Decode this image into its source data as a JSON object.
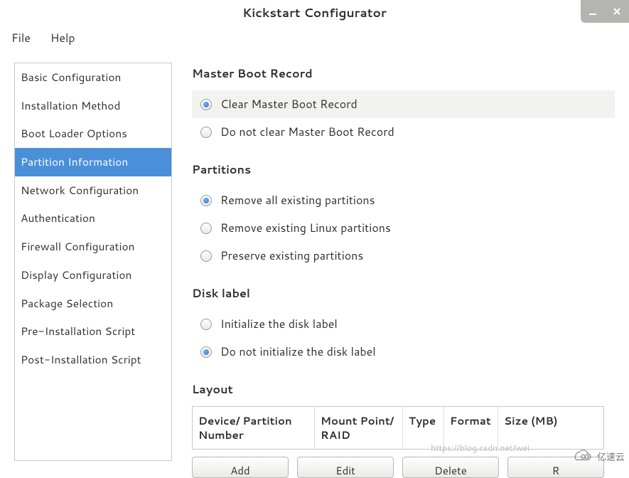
{
  "window": {
    "title": "Kickstart Configurator"
  },
  "menubar": {
    "file": "File",
    "help": "Help"
  },
  "sidebar": {
    "items": [
      "Basic Configuration",
      "Installation Method",
      "Boot Loader Options",
      "Partition Information",
      "Network Configuration",
      "Authentication",
      "Firewall Configuration",
      "Display Configuration",
      "Package Selection",
      "Pre-Installation Script",
      "Post-Installation Script"
    ],
    "selected_index": 3
  },
  "main": {
    "mbr": {
      "title": "Master Boot Record",
      "options": [
        "Clear Master Boot Record",
        "Do not clear Master Boot Record"
      ],
      "selected": 0
    },
    "partitions": {
      "title": "Partitions",
      "options": [
        "Remove all existing partitions",
        "Remove existing Linux partitions",
        "Preserve existing partitions"
      ],
      "selected": 0
    },
    "disklabel": {
      "title": "Disk label",
      "options": [
        "Initialize the disk label",
        "Do not initialize the disk label"
      ],
      "selected": 1
    },
    "layout": {
      "title": "Layout",
      "columns": {
        "device": "Device/\nPartition Number",
        "mount": "Mount Point/\nRAID",
        "type": "Type",
        "format": "Format",
        "size": "Size (MB)"
      },
      "buttons": {
        "add": "Add",
        "edit": "Edit",
        "delete": "Delete",
        "raid": "R"
      }
    }
  },
  "watermark": {
    "url": "https://blog.csdn.net/wei",
    "brand": "亿速云"
  }
}
